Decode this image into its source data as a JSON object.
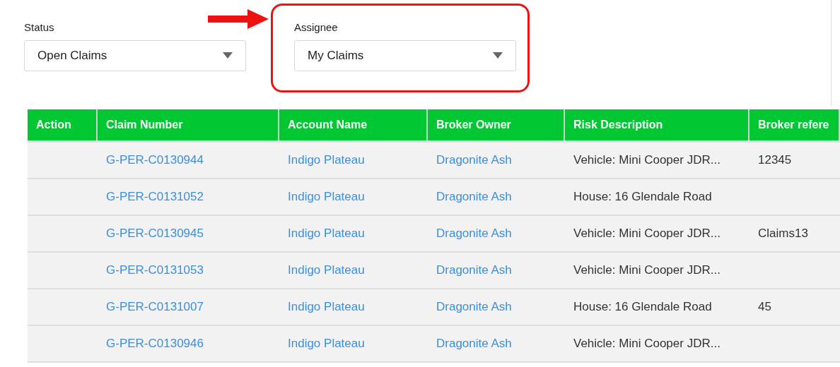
{
  "filters": [
    {
      "label": "Status",
      "value": "Open Claims",
      "highlighted": false
    },
    {
      "label": "Assignee",
      "value": "My Claims",
      "highlighted": true
    }
  ],
  "table": {
    "columns": [
      "Action",
      "Claim Number",
      "Account Name",
      "Broker Owner",
      "Risk Description",
      "Broker refere"
    ],
    "rows": [
      {
        "claim_number": "G-PER-C0130944",
        "account_name": "Indigo Plateau",
        "broker_owner": "Dragonite Ash",
        "risk_description": "Vehicle: Mini Cooper JDR...",
        "broker_reference": "12345"
      },
      {
        "claim_number": "G-PER-C0131052",
        "account_name": "Indigo Plateau",
        "broker_owner": "Dragonite Ash",
        "risk_description": "House: 16 Glendale Road"
      },
      {
        "claim_number": "G-PER-C0130945",
        "account_name": "Indigo Plateau",
        "broker_owner": "Dragonite Ash",
        "risk_description": "Vehicle: Mini Cooper JDR...",
        "broker_reference": "Claims13"
      },
      {
        "claim_number": "G-PER-C0131053",
        "account_name": "Indigo Plateau",
        "broker_owner": "Dragonite Ash",
        "risk_description": "Vehicle: Mini Cooper JDR..."
      },
      {
        "claim_number": "G-PER-C0131007",
        "account_name": "Indigo Plateau",
        "broker_owner": "Dragonite Ash",
        "risk_description": "House: 16 Glendale Road",
        "broker_reference": "45"
      },
      {
        "claim_number": "G-PER-C0130946",
        "account_name": "Indigo Plateau",
        "broker_owner": "Dragonite Ash",
        "risk_description": "Vehicle: Mini Cooper JDR..."
      }
    ]
  }
}
